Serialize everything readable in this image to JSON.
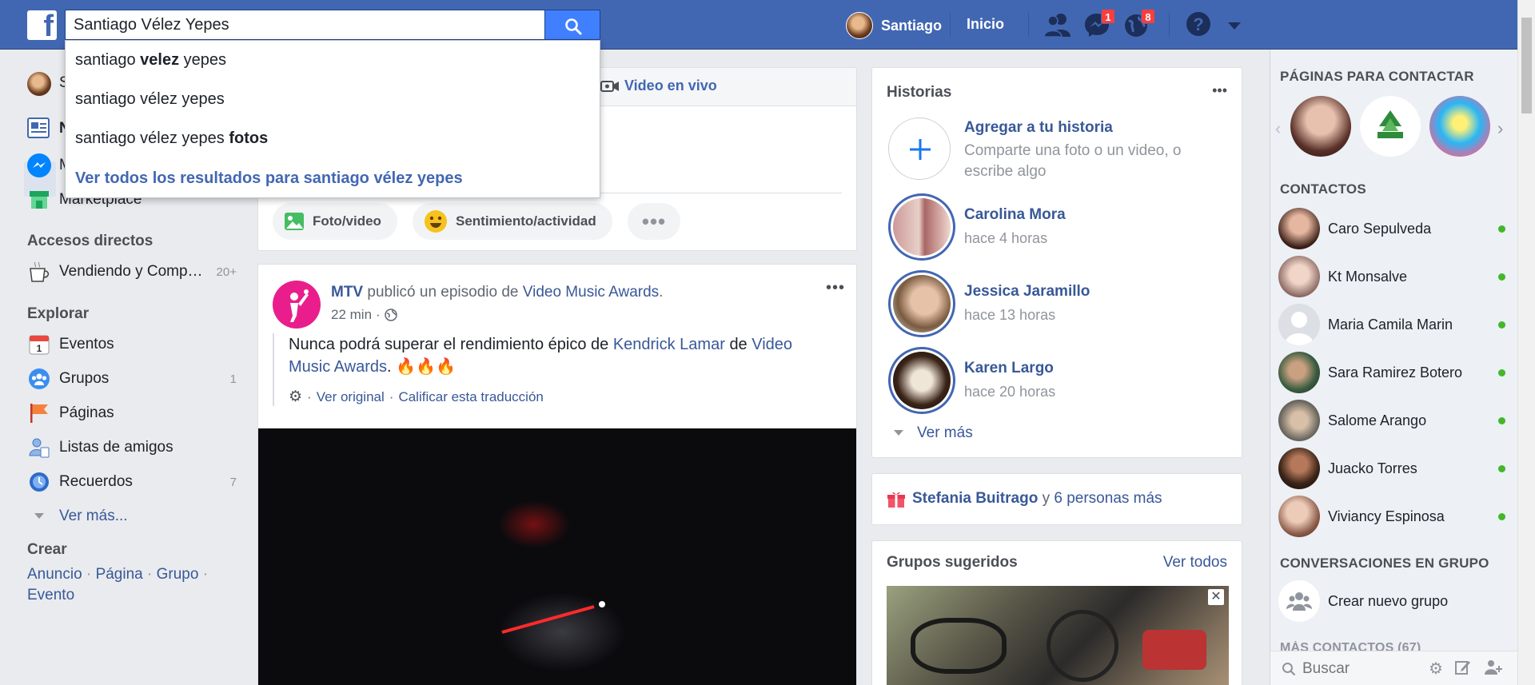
{
  "colors": {
    "brand": "#4267b2",
    "link": "#385898",
    "online": "#42b72a",
    "badge": "#fa3e3e"
  },
  "topbar": {
    "logo": "f",
    "search_value": "Santiago Vélez Yepes",
    "profile_name": "Santiago",
    "home": "Inicio",
    "messages_badge": "1",
    "notifications_badge": "8"
  },
  "suggestions": [
    {
      "pre": "santiago ",
      "bold": "velez",
      "post": " yepes"
    },
    {
      "pre": "santiago vélez yepes",
      "bold": "",
      "post": ""
    },
    {
      "pre": "santiago vélez yepes ",
      "bold": "fotos",
      "post": ""
    }
  ],
  "suggestions_all": "Ver todos los resultados para santiago vélez yepes",
  "left": {
    "profile_initial": "S",
    "news_initial": "N",
    "messenger_initial": "M",
    "marketplace": "Marketplace",
    "shortcuts_heading": "Accesos directos",
    "shortcut_item": "Vendiendo y Comp…",
    "shortcut_count": "20+",
    "explore_heading": "Explorar",
    "explore_items": [
      {
        "label": "Eventos",
        "count": ""
      },
      {
        "label": "Grupos",
        "count": "1"
      },
      {
        "label": "Páginas",
        "count": ""
      },
      {
        "label": "Listas de amigos",
        "count": ""
      },
      {
        "label": "Recuerdos",
        "count": "7"
      }
    ],
    "see_more": "Ver más...",
    "create_heading": "Crear",
    "create_links": [
      "Anuncio",
      "Página",
      "Grupo",
      "Evento"
    ]
  },
  "composer": {
    "live_video": "Video en vivo",
    "photo_video": "Foto/video",
    "feeling": "Sentimiento/actividad"
  },
  "post": {
    "author": "MTV",
    "action": "publicó un episodio de",
    "show": "Video Music Awards",
    "time": "22 min",
    "text_pre": "Nunca podrá superar el rendimiento épico de",
    "text_name": "Kendrick Lamar",
    "text_de": "de",
    "text_show": "Video Music Awards",
    "text_emoji": "🔥🔥🔥",
    "view_original": "Ver original",
    "rate_translation": "Calificar esta traducción"
  },
  "stories": {
    "title": "Historias",
    "add_title": "Agregar a tu historia",
    "add_sub": "Comparte una foto o un video, o escribe algo",
    "items": [
      {
        "name": "Carolina Mora",
        "time": "hace 4 horas"
      },
      {
        "name": "Jessica Jaramillo",
        "time": "hace 13 horas"
      },
      {
        "name": "Karen Largo",
        "time": "hace 20 horas"
      }
    ],
    "see_more": "Ver más"
  },
  "birthday": {
    "name": "Stefania Buitrago",
    "connector": "y",
    "others": "6 personas más"
  },
  "groups": {
    "title": "Grupos sugeridos",
    "see_all": "Ver todos"
  },
  "right": {
    "pages_heading": "PÁGINAS PARA CONTACTAR",
    "contacts_heading": "CONTACTOS",
    "contacts": [
      "Caro Sepulveda",
      "Kt Monsalve",
      "Maria Camila Marin",
      "Sara Ramirez Botero",
      "Salome Arango",
      "Juacko Torres",
      "Viviancy Espinosa"
    ],
    "group_conv_heading": "CONVERSACIONES EN GRUPO",
    "create_group": "Crear nuevo grupo",
    "more_contacts": "MÁS CONTACTOS (67)",
    "search_placeholder": "Buscar"
  }
}
